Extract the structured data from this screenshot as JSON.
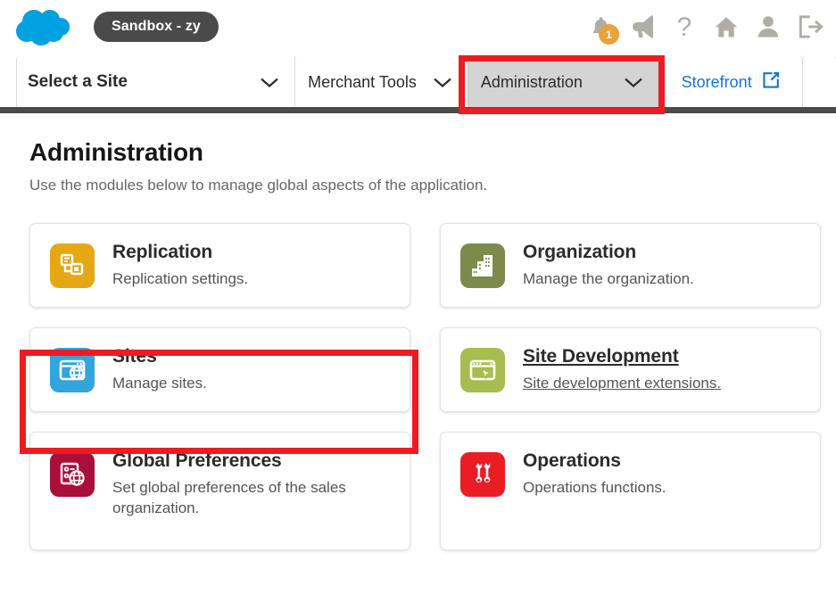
{
  "header": {
    "logo_icon": "cloud-logo",
    "sandbox_label": "Sandbox - zy",
    "icons": [
      {
        "name": "notifications-bell-icon",
        "badge": "1"
      },
      {
        "name": "megaphone-announcements-icon",
        "badge": ""
      },
      {
        "name": "help-question-icon",
        "badge": ""
      },
      {
        "name": "home-icon",
        "badge": ""
      },
      {
        "name": "user-account-icon",
        "badge": ""
      },
      {
        "name": "logout-icon",
        "badge": ""
      }
    ]
  },
  "nav": {
    "site_select": "Select a Site",
    "merchant_tools": "Merchant Tools",
    "administration": "Administration",
    "storefront": "Storefront",
    "active_tab": "Administration",
    "chevron_glyph": "chevron-down-icon",
    "external_link_glyph": "external-link-icon"
  },
  "main": {
    "title": "Administration",
    "subtitle": "Use the modules below to manage global aspects of the application.",
    "modules": [
      {
        "title": "Replication",
        "description": "Replication settings.",
        "icon": "replication-icon",
        "icon_color": "#e5a812",
        "hovered": false,
        "slug": "replication"
      },
      {
        "title": "Organization",
        "description": "Manage the organization.",
        "icon": "organization-building-icon",
        "icon_color": "#7d8a4a",
        "hovered": false,
        "slug": "organization"
      },
      {
        "title": "Sites",
        "description": "Manage sites.",
        "icon": "sites-globe-window-icon",
        "icon_color": "#31a5dc",
        "hovered": false,
        "slug": "sites"
      },
      {
        "title": "Site Development",
        "description": "Site development extensions.",
        "icon": "site-development-cursor-window-icon",
        "icon_color": "#a8bd4f",
        "hovered": true,
        "slug": "site-development"
      },
      {
        "title": "Global Preferences",
        "description": "Set global preferences of the sales organization.",
        "icon": "global-preferences-icon",
        "icon_color": "#a90f3a",
        "hovered": false,
        "slug": "global-preferences"
      },
      {
        "title": "Operations",
        "description": "Operations functions.",
        "icon": "operations-wrench-icon",
        "icon_color": "#eb1c24",
        "hovered": false,
        "slug": "operations"
      }
    ]
  },
  "annotations": {
    "color": "#ee1b22",
    "boxes": [
      {
        "name": "administration-tab-highlight",
        "target": "Administration"
      },
      {
        "name": "sites-card-highlight",
        "target": "Sites"
      }
    ]
  }
}
